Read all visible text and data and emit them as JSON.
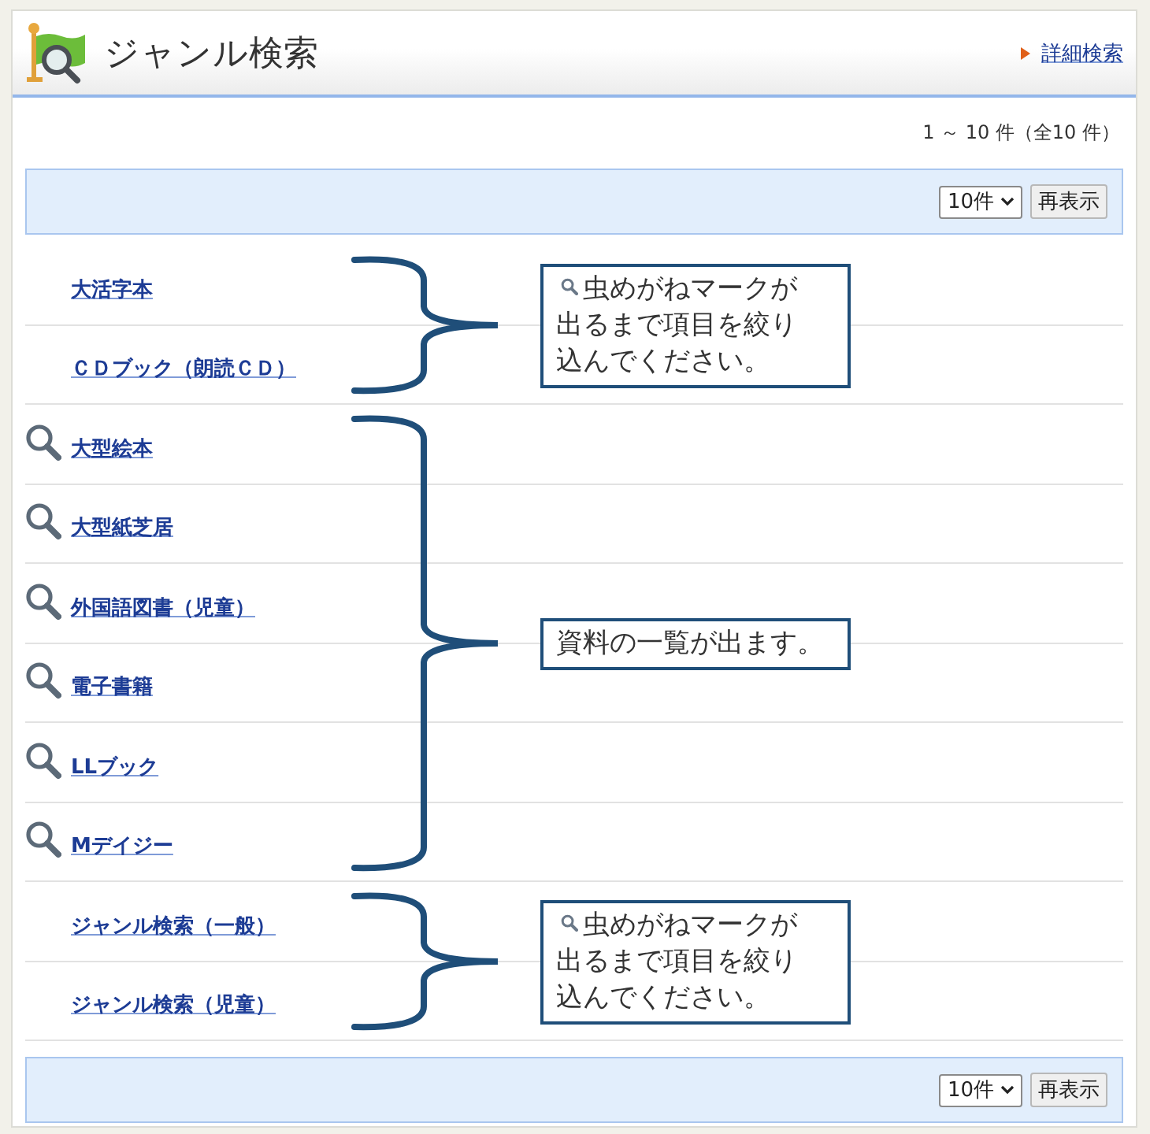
{
  "header": {
    "title": "ジャンル検索",
    "link": "詳細検索"
  },
  "result_count": "1 ～ 10 件（全10 件）",
  "top_toolbar": {
    "per_page": "10件",
    "button": "再表示"
  },
  "groups": [
    {
      "items": [
        {
          "label": "大活字本",
          "search_icon": false
        },
        {
          "label": "ＣＤブック（朗読ＣＤ）",
          "search_icon": false
        }
      ],
      "note": {
        "search_icon": true,
        "lines": [
          "虫めがねマークが",
          "出るまで項目を絞り",
          "込んでください。"
        ]
      }
    },
    {
      "items": [
        {
          "label": "大型絵本",
          "search_icon": true
        },
        {
          "label": "大型紙芝居",
          "search_icon": true
        },
        {
          "label": "外国語図書（児童）",
          "search_icon": true
        },
        {
          "label": "電子書籍",
          "search_icon": true
        },
        {
          "label": "LLブック",
          "search_icon": true
        },
        {
          "label": "Mデイジー",
          "search_icon": true
        }
      ],
      "note": {
        "search_icon": false,
        "lines": [
          "資料の一覧が出ます。"
        ]
      }
    },
    {
      "items": [
        {
          "label": "ジャンル検索（一般）",
          "search_icon": false
        },
        {
          "label": "ジャンル検索（児童）",
          "search_icon": false
        }
      ],
      "note": {
        "search_icon": true,
        "lines": [
          "虫めがねマークが",
          "出るまで項目を絞り",
          "込んでください。"
        ]
      }
    }
  ],
  "bottom_toolbar": {
    "per_page": "10件",
    "button": "再表示"
  }
}
